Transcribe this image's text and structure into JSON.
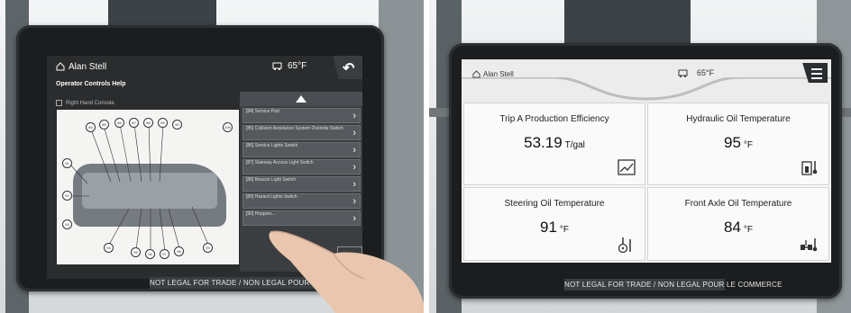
{
  "left_photo": {
    "header": {
      "user_name": "Alan Stell",
      "temperature": "65°F"
    },
    "subtitle": "Operator Controls Help",
    "checkbox_label": "Right Hand Console",
    "list_items": [
      {
        "code": "[84]",
        "label": "Service Part"
      },
      {
        "code": "[85]",
        "label": "Collision Avoidance System Override Switch"
      },
      {
        "code": "[86]",
        "label": "Service Lights Switch"
      },
      {
        "code": "[87]",
        "label": "Stairway Access Light Switch"
      },
      {
        "code": "[88]",
        "label": "Beacon Light Switch"
      },
      {
        "code": "[89]",
        "label": "Hazard Lights Switch"
      },
      {
        "code": "[90]",
        "label": "Hoppers..."
      }
    ],
    "diagram_callouts": [
      "84",
      "85",
      "86",
      "87",
      "88",
      "89",
      "90",
      "91",
      "92",
      "93",
      "94",
      "95",
      "96",
      "97",
      "98",
      "99",
      "100",
      "101",
      "102",
      "103"
    ],
    "legal_text": "NOT LEGAL FOR TRADE / NON LEGAL POUR LE COMMERCE"
  },
  "right_photo": {
    "header": {
      "user_name": "Alan Stell",
      "temperature": "65°F"
    },
    "tiles": [
      {
        "title": "Trip A Production Efficiency",
        "value": "53.19",
        "unit": "T/gal",
        "icon": "chart-trend-icon"
      },
      {
        "title": "Hydraulic Oil Temperature",
        "value": "95",
        "unit": "°F",
        "icon": "hydraulic-temp-icon"
      },
      {
        "title": "Steering Oil Temperature",
        "value": "91",
        "unit": "°F",
        "icon": "steering-temp-icon"
      },
      {
        "title": "Front Axle Oil Temperature",
        "value": "84",
        "unit": "°F",
        "icon": "axle-temp-icon"
      }
    ],
    "legal_text": "NOT LEGAL FOR TRADE / NON LEGAL POUR LE COMMERCE"
  },
  "colors": {
    "bezel": "#1b1d1f",
    "left_screen_bg": "#2a2c2e",
    "right_screen_bg": "#f7f7f7",
    "list_item_bg": "#55595d"
  }
}
